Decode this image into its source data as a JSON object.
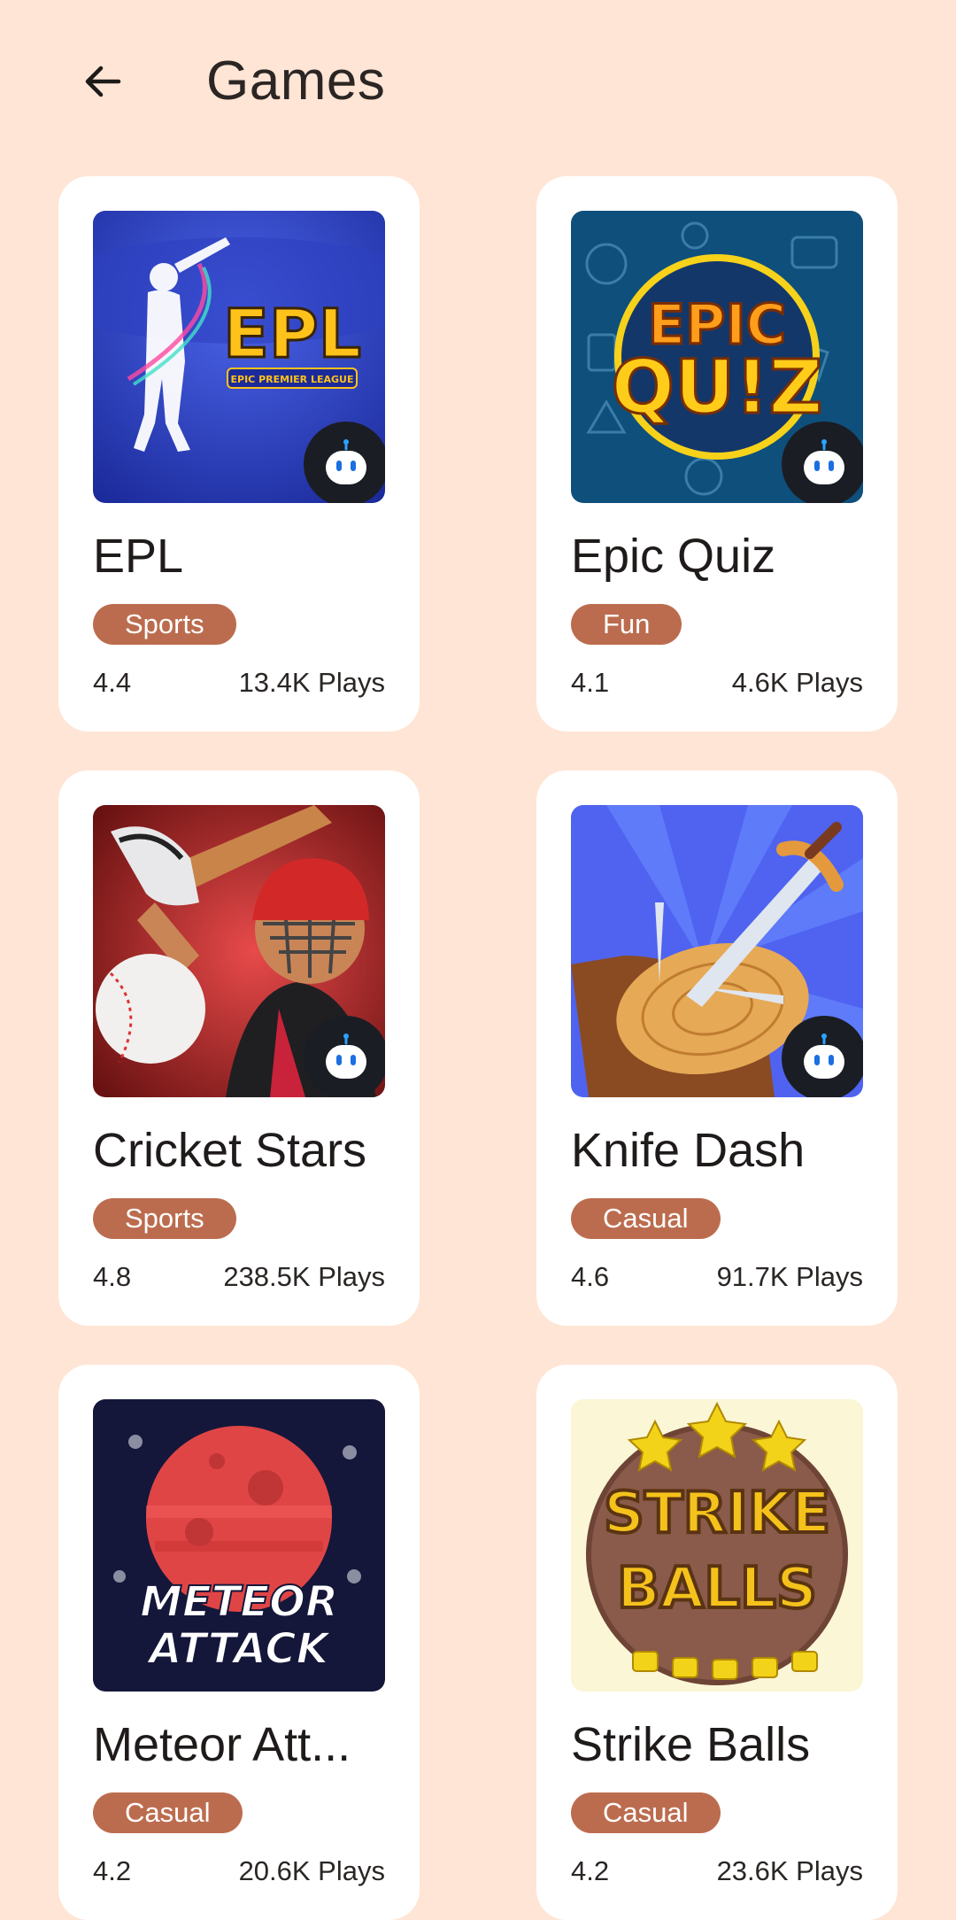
{
  "header": {
    "title": "Games",
    "back_icon": "arrow-left-icon"
  },
  "colors": {
    "background": "#FFE5D5",
    "card": "#FFFFFF",
    "chip": "#BC6C4E"
  },
  "games": [
    {
      "name": "EPL",
      "category": "Sports",
      "rating": "4.4",
      "plays": "13.4K Plays",
      "art_text": "EPL",
      "art_subtext": "EPIC PREMIER LEAGUE",
      "badge_icon": "robot-icon"
    },
    {
      "name": "Epic Quiz",
      "category": "Fun",
      "rating": "4.1",
      "plays": "4.6K Plays",
      "art_text": "EPIC",
      "art_subtext": "QU!Z",
      "badge_icon": "robot-icon"
    },
    {
      "name": "Cricket Stars",
      "category": "Sports",
      "rating": "4.8",
      "plays": "238.5K Plays",
      "badge_icon": "robot-icon"
    },
    {
      "name": "Knife Dash",
      "category": "Casual",
      "rating": "4.6",
      "plays": "91.7K Plays",
      "badge_icon": "robot-icon"
    },
    {
      "name": "Meteor Att...",
      "category": "Casual",
      "rating": "4.2",
      "plays": "20.6K Plays",
      "art_text": "METEOR",
      "art_subtext": "ATTACK"
    },
    {
      "name": "Strike Balls",
      "category": "Casual",
      "rating": "4.2",
      "plays": "23.6K Plays",
      "art_text": "STRIKE",
      "art_subtext": "BALLS"
    }
  ]
}
